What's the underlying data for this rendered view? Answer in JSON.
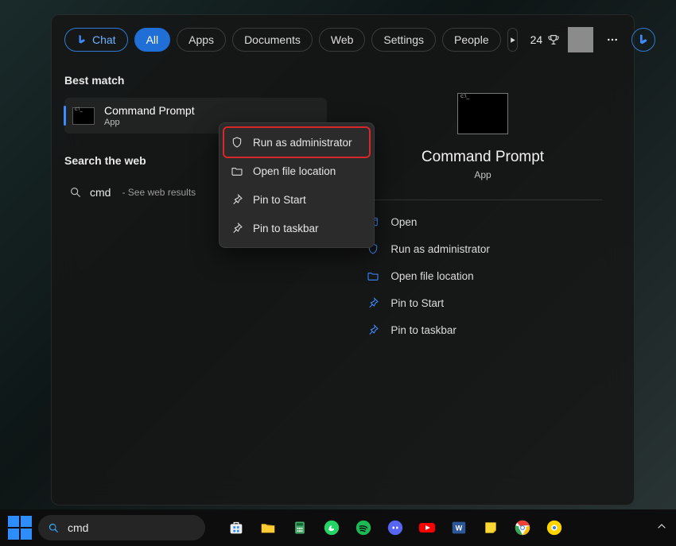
{
  "tabs": {
    "chat": "Chat",
    "all": "All",
    "apps": "Apps",
    "documents": "Documents",
    "web": "Web",
    "settings": "Settings",
    "people": "People"
  },
  "points": "24",
  "left": {
    "best_match": "Best match",
    "result_title": "Command Prompt",
    "result_sub": "App",
    "search_web": "Search the web",
    "web_q": "cmd",
    "web_hint": "- See web results"
  },
  "preview": {
    "title": "Command Prompt",
    "sub": "App",
    "open": "Open",
    "admin": "Run as administrator",
    "loc": "Open file location",
    "pin_start": "Pin to Start",
    "pin_task": "Pin to taskbar"
  },
  "ctx": {
    "admin": "Run as administrator",
    "loc": "Open file location",
    "pin_start": "Pin to Start",
    "pin_task": "Pin to taskbar"
  },
  "taskbar": {
    "search_value": "cmd"
  }
}
